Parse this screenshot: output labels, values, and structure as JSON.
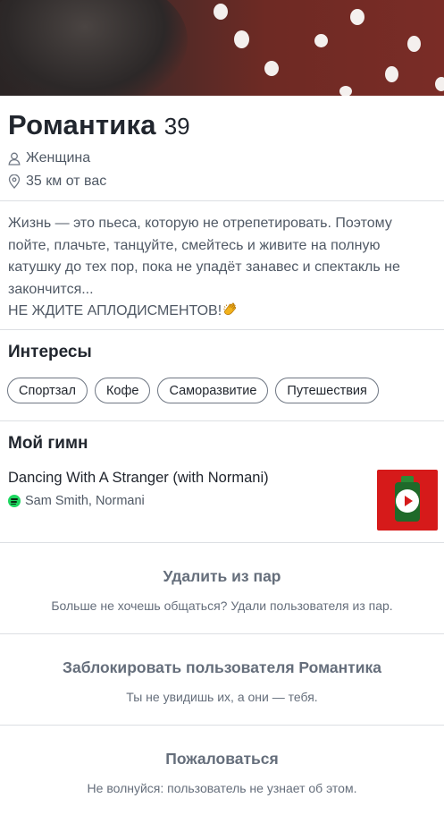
{
  "profile": {
    "name": "Романтика",
    "age": "39",
    "gender": "Женщина",
    "distance": "35 км от вас",
    "bio_lines": [
      "Жизнь — это пьеса, которую не отрепетировать. Поэтому пойте, плачьте, танцуйте, смейтесь и живите на полную катушку до тех пор, пока не упадёт занавес и спектакль не закончится...",
      "НЕ ЖДИТЕ АПЛОДИСМЕНТОВ!"
    ],
    "bio_emoji": "clapping-hands-icon"
  },
  "interests": {
    "title": "Интересы",
    "items": [
      "Спортзал",
      "Кофе",
      "Саморазвитие",
      "Путешествия"
    ]
  },
  "anthem": {
    "title": "Мой гимн",
    "song": "Dancing With A Stranger (with Normani)",
    "artists": "Sam Smith, Normani",
    "service_icon": "spotify-icon",
    "album_art_icon": "album-art-play-icon"
  },
  "actions": {
    "unmatch": {
      "title": "Удалить из пар",
      "subtitle": "Больше не хочешь общаться? Удали пользователя из пар."
    },
    "block": {
      "title": "Заблокировать пользователя Романтика",
      "subtitle": "Ты не увидишь их, а они — тебя."
    },
    "report": {
      "title": "Пожаловаться",
      "subtitle": "Не волнуйся: пользователь не узнает об этом."
    }
  },
  "colors": {
    "text_primary": "#21262e",
    "text_secondary": "#505965",
    "action_text": "#656e7b",
    "divider": "#dcdfe3",
    "spotify_green": "#1ed760",
    "album_red": "#d61a1a"
  }
}
